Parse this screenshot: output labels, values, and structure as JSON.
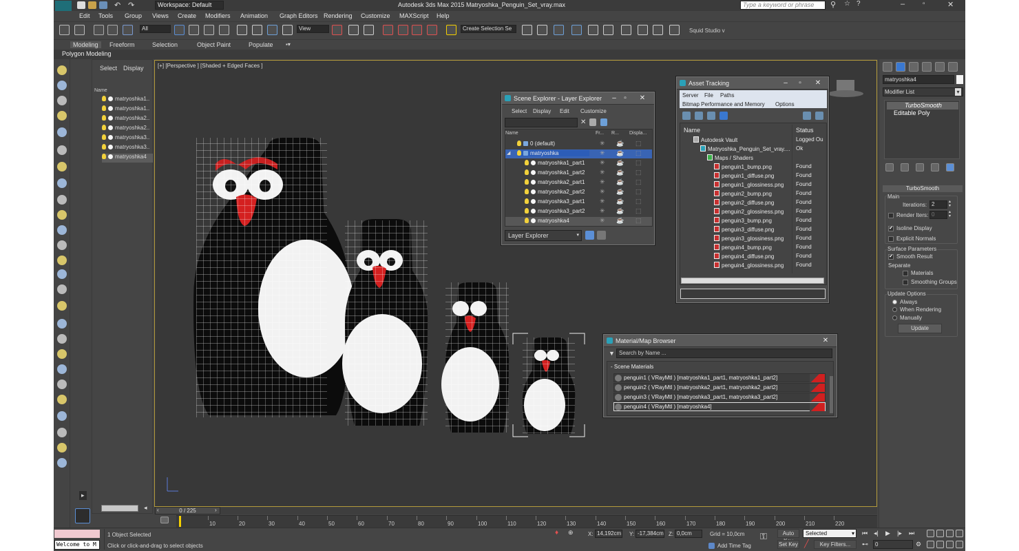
{
  "titlebar": {
    "workspace": "Workspace: Default",
    "title": "Autodesk 3ds Max  2015    Matryoshka_Penguin_Set_vray.max",
    "search_placeholder": "Type a keyword or phrase"
  },
  "menu": [
    "Edit",
    "Tools",
    "Group",
    "Views",
    "Create",
    "Modifiers",
    "Animation",
    "Graph Editors",
    "Rendering",
    "Customize",
    "MAXScript",
    "Help"
  ],
  "toolbar": {
    "filter": "All",
    "view": "View",
    "selection_set": "Create Selection Se",
    "squid": "Squid Studio v"
  },
  "ribbon": {
    "tabs": [
      "Modeling",
      "Freeform",
      "Selection",
      "Object Paint",
      "Populate"
    ],
    "panel": "Polygon Modeling"
  },
  "scene_list": {
    "tabs": [
      "Select",
      "Display"
    ],
    "header": "Name",
    "items": [
      "matryoshka1..",
      "matryoshka1..",
      "matryoshka2..",
      "matryoshka2..",
      "matryoshka3..",
      "matryoshka3..",
      "matryoshka4"
    ]
  },
  "viewport": {
    "label": "[+] [Perspective ] [Shaded + Edged Faces ]",
    "frame": "0 / 225"
  },
  "scene_explorer": {
    "title": "Scene Explorer - Layer Explorer",
    "menu": [
      "Select",
      "Display",
      "Edit",
      "Customize"
    ],
    "columns": [
      "Name",
      "Fr...",
      "R...",
      "Displa..."
    ],
    "rows": [
      {
        "name": "0 (default)",
        "indent": 1
      },
      {
        "name": "matryoshka",
        "indent": 1
      },
      {
        "name": "matryoshka1_part1",
        "indent": 2
      },
      {
        "name": "matryoshka1_part2",
        "indent": 2
      },
      {
        "name": "matryoshka2_part1",
        "indent": 2
      },
      {
        "name": "matryoshka2_part2",
        "indent": 2
      },
      {
        "name": "matryoshka3_part1",
        "indent": 2
      },
      {
        "name": "matryoshka3_part2",
        "indent": 2
      },
      {
        "name": "matryoshka4",
        "indent": 2
      }
    ],
    "footer": "Layer Explorer"
  },
  "asset_tracking": {
    "title": "Asset Tracking",
    "menu": [
      "Server",
      "File",
      "Paths"
    ],
    "menu2": [
      "Bitmap Performance and Memory",
      "Options"
    ],
    "columns": [
      "Name",
      "Status"
    ],
    "rows": [
      {
        "name": "Autodesk Vault",
        "status": "Logged Ou"
      },
      {
        "name": "Matryoshka_Penguin_Set_vray....",
        "status": "Ok"
      },
      {
        "name": "Maps / Shaders",
        "status": ""
      },
      {
        "name": "penguin1_bump.png",
        "status": "Found"
      },
      {
        "name": "penguin1_diffuse.png",
        "status": "Found"
      },
      {
        "name": "penguin1_glossiness.png",
        "status": "Found"
      },
      {
        "name": "penguin2_bump.png",
        "status": "Found"
      },
      {
        "name": "penguin2_diffuse.png",
        "status": "Found"
      },
      {
        "name": "penguin2_glossiness.png",
        "status": "Found"
      },
      {
        "name": "penguin3_bump.png",
        "status": "Found"
      },
      {
        "name": "penguin3_diffuse.png",
        "status": "Found"
      },
      {
        "name": "penguin3_glossiness.png",
        "status": "Found"
      },
      {
        "name": "penguin4_bump.png",
        "status": "Found"
      },
      {
        "name": "penguin4_diffuse.png",
        "status": "Found"
      },
      {
        "name": "penguin4_glossiness.png",
        "status": "Found"
      }
    ]
  },
  "material_browser": {
    "title": "Material/Map Browser",
    "search": "Search by Name ...",
    "section": "- Scene Materials",
    "items": [
      "penguin1  ( VRayMtl )  [matryoshka1_part1, matryoshka1_part2]",
      "penguin2  ( VRayMtl )  [matryoshka2_part1, matryoshka2_part2]",
      "penguin3  ( VRayMtl )  [matryoshka3_part1, matryoshka3_part2]",
      "penguin4  ( VRayMtl )  [matryoshka4]"
    ]
  },
  "command_panel": {
    "object_name": "matryoshka4",
    "modifier_list": "Modifier List",
    "stack": [
      "TurboSmooth",
      "Editable Poly"
    ],
    "rollout": "TurboSmooth",
    "main": "Main",
    "iterations_label": "Iterations:",
    "iterations": "2",
    "render_iters_label": "Render Iters:",
    "render_iters": "0",
    "isoline": "Isoline Display",
    "explicit": "Explicit Normals",
    "surface_params": "Surface Parameters",
    "smooth_result": "Smooth Result",
    "separate": "Separate",
    "materials": "Materials",
    "smoothing_groups": "Smoothing Groups",
    "update_options": "Update Options",
    "always": "Always",
    "when_rendering": "When Rendering",
    "manually": "Manually",
    "update": "Update"
  },
  "timeline": {
    "ticks": [
      "10",
      "20",
      "30",
      "40",
      "50",
      "60",
      "70",
      "80",
      "90",
      "100",
      "110",
      "120",
      "130",
      "140",
      "150",
      "160",
      "170",
      "180",
      "190",
      "200",
      "210",
      "220"
    ]
  },
  "status": {
    "script": "Welcome to M",
    "selected": "1 Object Selected",
    "hint": "Click or click-and-drag to select objects",
    "x": "14,192cm",
    "y": "-17,384cm",
    "z": "0,0cm",
    "grid": "Grid = 10,0cm",
    "add_time_tag": "Add Time Tag",
    "auto_key": "Auto Key",
    "selected_dd": "Selected",
    "set_key": "Set Key",
    "key_filters": "Key Filters...",
    "frame": "0"
  }
}
